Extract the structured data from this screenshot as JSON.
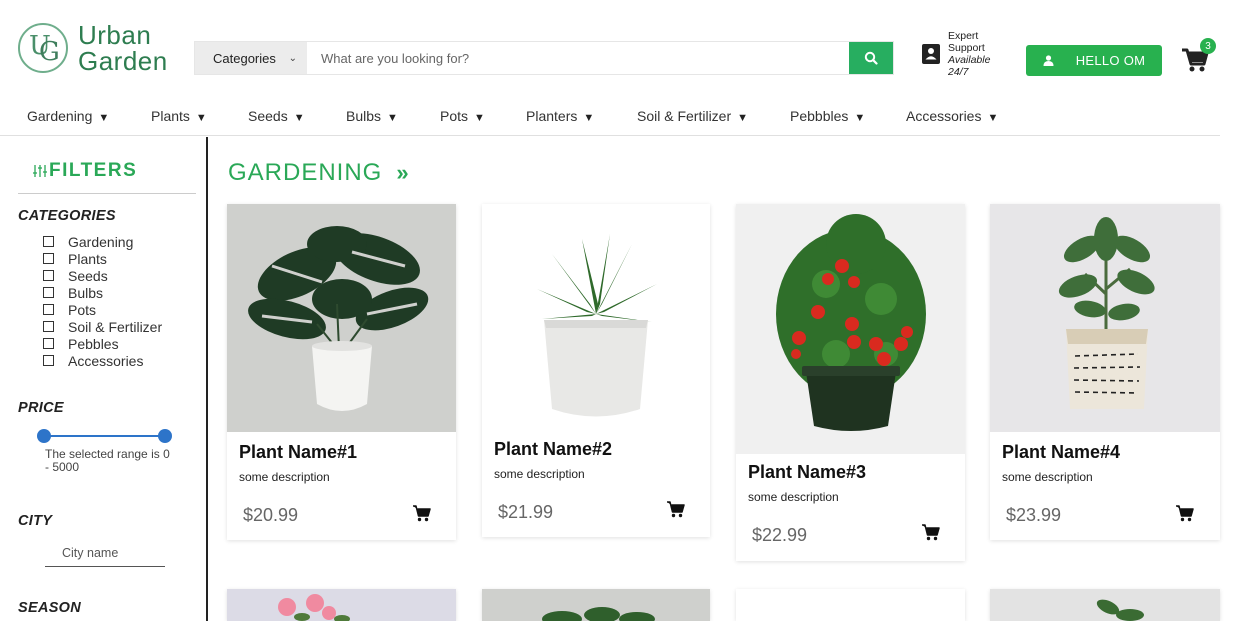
{
  "brand": {
    "line1": "Urban",
    "line2": "Garden"
  },
  "search": {
    "category_label": "Categories",
    "placeholder": "What are you looking for?"
  },
  "support": {
    "line1": "Expert",
    "line2": "Support",
    "line3": "Available",
    "line4": "24/7"
  },
  "user": {
    "hello_label": "HELLO OM"
  },
  "cart": {
    "count": "3"
  },
  "nav": {
    "items": [
      {
        "label": "Gardening"
      },
      {
        "label": "Plants"
      },
      {
        "label": "Seeds"
      },
      {
        "label": "Bulbs"
      },
      {
        "label": "Pots"
      },
      {
        "label": "Planters"
      },
      {
        "label": "Soil & Fertilizer"
      },
      {
        "label": "Pebbbles"
      },
      {
        "label": "Accessories"
      }
    ]
  },
  "filters": {
    "title": "FILTERS",
    "categories_title": "CATEGORIES",
    "categories": [
      "Gardening",
      "Plants",
      "Seeds",
      "Bulbs",
      "Pots",
      "Soil & Fertilizer",
      "Pebbles",
      "Accessories"
    ],
    "price_title": "PRICE",
    "price_range_text": "The selected range is 0 - 5000",
    "price_range": {
      "min": 0,
      "max": 5000
    },
    "city_title": "CITY",
    "city_placeholder": "City name",
    "season_title": "SEASON"
  },
  "main": {
    "title": "GARDENING",
    "arrow": "»"
  },
  "products": [
    {
      "name": "Plant Name#1",
      "description": "some description",
      "price": "$20.99"
    },
    {
      "name": "Plant Name#2",
      "description": "some description",
      "price": "$21.99"
    },
    {
      "name": "Plant Name#3",
      "description": "some description",
      "price": "$22.99"
    },
    {
      "name": "Plant Name#4",
      "description": "some description",
      "price": "$23.99"
    }
  ],
  "colors": {
    "accent": "#28b14f",
    "slider": "#2d74c9"
  }
}
